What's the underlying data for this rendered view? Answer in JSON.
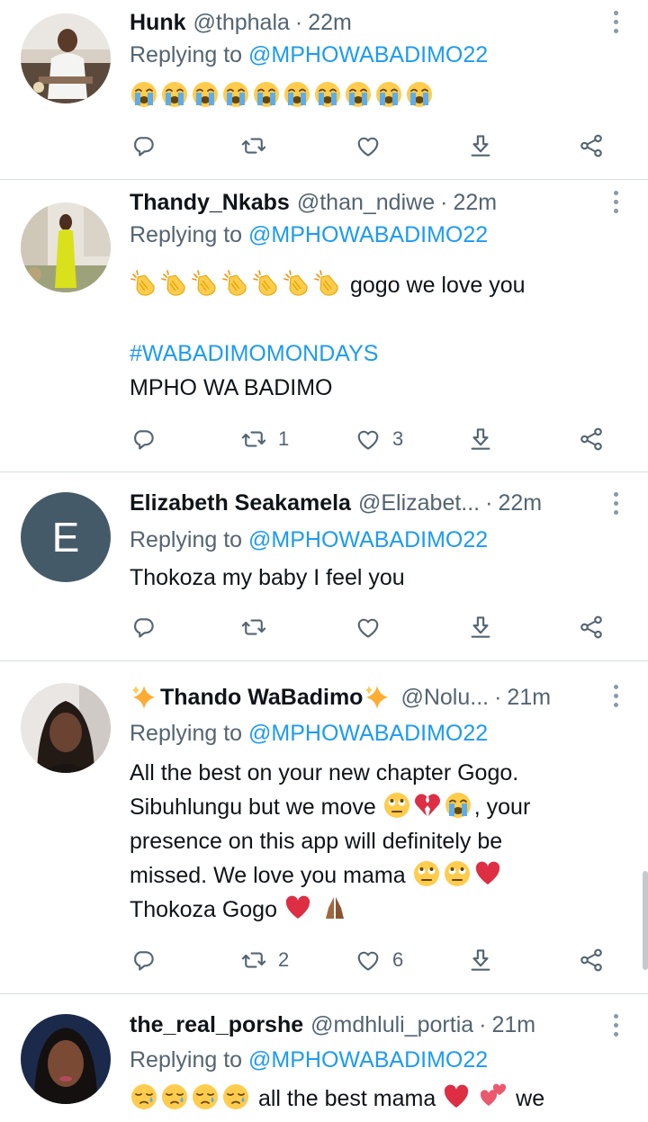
{
  "tweets": [
    {
      "name": "Hunk",
      "handle": "@thphala",
      "time": "22m",
      "replying_prefix": "Replying to",
      "replying_to": "@MPHOWABADIMO22",
      "emojis": [
        "loudly-crying",
        "loudly-crying",
        "loudly-crying",
        "loudly-crying",
        "loudly-crying",
        "loudly-crying",
        "loudly-crying",
        "loudly-crying",
        "loudly-crying",
        "loudly-crying"
      ],
      "text": "",
      "retweets": "",
      "likes": ""
    },
    {
      "name": "Thandy_Nkabs",
      "handle": "@than_ndiwe",
      "time": "22m",
      "replying_prefix": "Replying to",
      "replying_to": "@MPHOWABADIMO22",
      "emojis": [
        "clapping-hands",
        "clapping-hands",
        "clapping-hands",
        "clapping-hands",
        "clapping-hands",
        "clapping-hands",
        "clapping-hands"
      ],
      "text": "gogo we love you",
      "hashtag": "#WABADIMOMONDAYS",
      "text2": "MPHO WA BADIMO",
      "retweets": "1",
      "likes": "3"
    },
    {
      "name": "Elizabeth Seakamela",
      "handle": "@Elizabet...",
      "time": "22m",
      "avatar_letter": "E",
      "replying_prefix": "Replying to",
      "replying_to": "@MPHOWABADIMO22",
      "text": "Thokoza my baby I feel you",
      "retweets": "",
      "likes": ""
    },
    {
      "name": "Thando WaBadimo",
      "name_decoration": "sparkles",
      "handle": "@Nolu...",
      "time": "21m",
      "replying_prefix": "Replying to",
      "replying_to": "@MPHOWABADIMO22",
      "line1": "All the best on your new chapter Gogo.",
      "line2a": "Sibuhlungu but we move",
      "line2b": ", your",
      "line3": "presence on this app will definitely be",
      "line4": "missed. We love you mama",
      "line5": "Thokoza Gogo",
      "retweets": "2",
      "likes": "6"
    },
    {
      "name": "the_real_porshe",
      "handle": "@mdhluli_portia",
      "time": "21m",
      "replying_prefix": "Replying to",
      "replying_to": "@MPHOWABADIMO22",
      "text_a": "all the best mama",
      "text_b": "we"
    }
  ],
  "separator": "·",
  "colors": {
    "accent": "#1d9bf0",
    "secondary_text": "#536471",
    "divider": "#d9dde1",
    "avatar_letter_bg": "#455a69"
  },
  "icons": {
    "reply": "reply-icon",
    "retweet": "retweet-icon",
    "like": "heart-icon",
    "download": "download-icon",
    "share": "share-icon",
    "more": "more-icon"
  }
}
